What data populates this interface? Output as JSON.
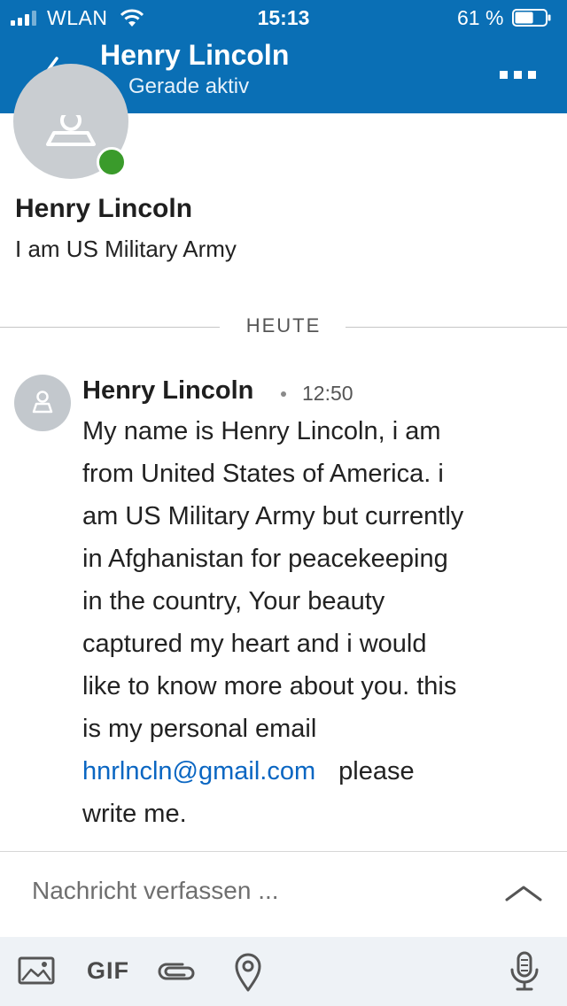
{
  "status_bar": {
    "carrier": "WLAN",
    "time": "15:13",
    "battery_percent": "61 %",
    "battery_level": 0.61
  },
  "nav": {
    "title": "Henry Lincoln",
    "subtitle": "Gerade aktiv",
    "presence_color": "#38a02c"
  },
  "profile": {
    "name": "Henry Lincoln",
    "headline": "I am US Military Army"
  },
  "divider": {
    "label": "HEUTE"
  },
  "message": {
    "sender": "Henry Lincoln",
    "time": "12:50",
    "lines": [
      "My name is Henry Lincoln, i am",
      "from United States of America. i",
      "am US Military Army but currently",
      "in Afghanistan for peacekeeping",
      "in the country, Your beauty",
      "captured my heart and i would",
      "like to know more about you. this",
      "is my personal email"
    ],
    "email": "hnrlncln@gmail.com",
    "after_email": "please",
    "last_line": "write me."
  },
  "composer": {
    "placeholder": "Nachricht verfassen ...",
    "value": ""
  },
  "toolbar": {
    "gif_label": "GIF",
    "icons": [
      "image-icon",
      "gif-icon",
      "paperclip-icon",
      "location-pin-icon",
      "microphone-icon"
    ]
  },
  "colors": {
    "header_bg": "#0a6fb5",
    "link": "#0a66c2",
    "toolbar_bg": "#eef2f6"
  }
}
